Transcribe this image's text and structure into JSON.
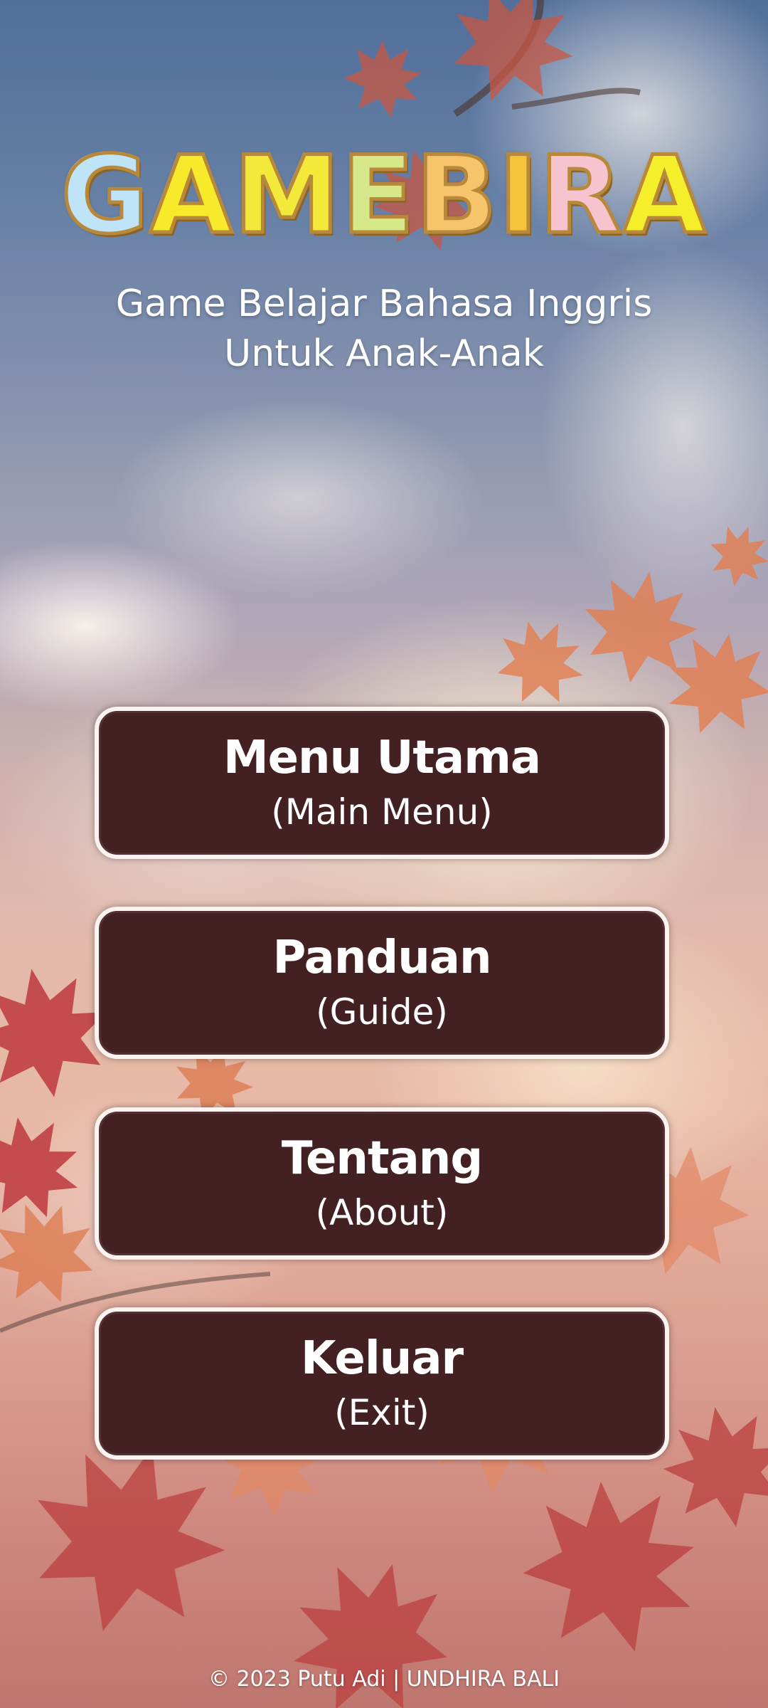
{
  "title": {
    "letters": [
      "G",
      "A",
      "M",
      "E",
      "B",
      "I",
      "R",
      "A"
    ],
    "letter_colors": [
      "#bfe3f7",
      "#f6ea2a",
      "#f3e93a",
      "#d7e88a",
      "#f6c46a",
      "#f6c43a",
      "#f7c3cf",
      "#f5ee2a"
    ]
  },
  "subtitle": {
    "line1": "Game Belajar Bahasa Inggris",
    "line2": "Untuk Anak-Anak"
  },
  "menu": {
    "items": [
      {
        "main": "Menu Utama",
        "sub": "(Main Menu)"
      },
      {
        "main": "Panduan",
        "sub": "(Guide)"
      },
      {
        "main": "Tentang",
        "sub": "(About)"
      },
      {
        "main": "Keluar",
        "sub": "(Exit)"
      }
    ]
  },
  "footer": {
    "text": "© 2023 Putu Adi | UNDHIRA BALI"
  },
  "colors": {
    "button_bg": "#432022",
    "button_border": "#fbf3f0"
  }
}
